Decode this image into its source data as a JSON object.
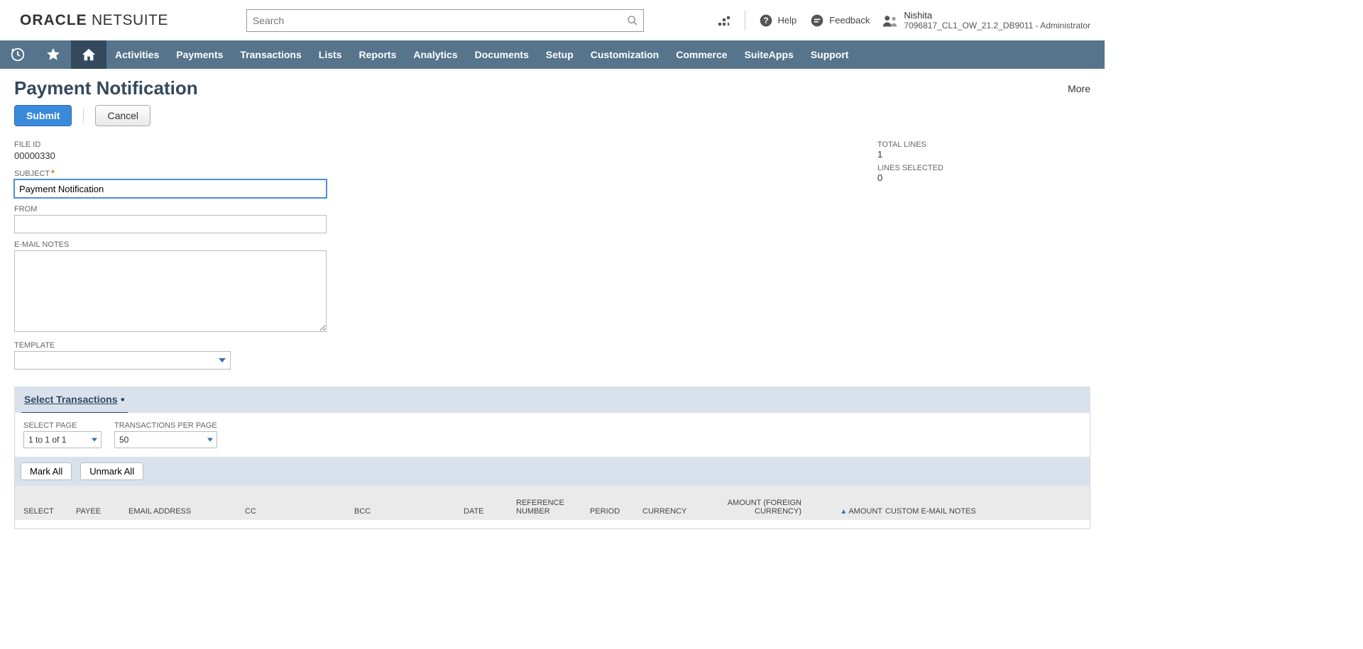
{
  "header": {
    "logo": {
      "brand": "ORACLE",
      "product": "NETSUITE"
    },
    "search": {
      "placeholder": "Search"
    },
    "right": {
      "help_label": "Help",
      "feedback_label": "Feedback",
      "user_name": "Nishita",
      "user_context": "7096817_CL1_OW_21.2_DB9011 - Administrator"
    }
  },
  "nav": {
    "items": [
      "Activities",
      "Payments",
      "Transactions",
      "Lists",
      "Reports",
      "Analytics",
      "Documents",
      "Setup",
      "Customization",
      "Commerce",
      "SuiteApps",
      "Support"
    ]
  },
  "page": {
    "title": "Payment Notification",
    "more_label": "More",
    "buttons": {
      "submit": "Submit",
      "cancel": "Cancel"
    },
    "fields": {
      "file_id_label": "FILE ID",
      "file_id_value": "00000330",
      "subject_label": "SUBJECT",
      "subject_value": "Payment Notification",
      "from_label": "FROM",
      "from_value": "",
      "email_notes_label": "E-MAIL NOTES",
      "email_notes_value": "",
      "template_label": "TEMPLATE",
      "template_value": ""
    },
    "totals": {
      "total_lines_label": "TOTAL LINES",
      "total_lines_value": "1",
      "lines_selected_label": "LINES SELECTED",
      "lines_selected_value": "0"
    }
  },
  "section": {
    "tab_label": "Select Transactions",
    "filters": {
      "select_page_label": "SELECT PAGE",
      "select_page_value": "1 to 1 of 1",
      "per_page_label": "TRANSACTIONS PER PAGE",
      "per_page_value": "50"
    },
    "bulk": {
      "mark_all": "Mark All",
      "unmark_all": "Unmark All"
    },
    "columns": {
      "select": "SELECT",
      "payee": "PAYEE",
      "email": "EMAIL ADDRESS",
      "cc": "CC",
      "bcc": "BCC",
      "date": "DATE",
      "refnum": "REFERENCE NUMBER",
      "period": "PERIOD",
      "currency": "CURRENCY",
      "fx_amount": "AMOUNT (FOREIGN CURRENCY)",
      "amount": "AMOUNT",
      "notes": "CUSTOM E-MAIL NOTES"
    }
  }
}
